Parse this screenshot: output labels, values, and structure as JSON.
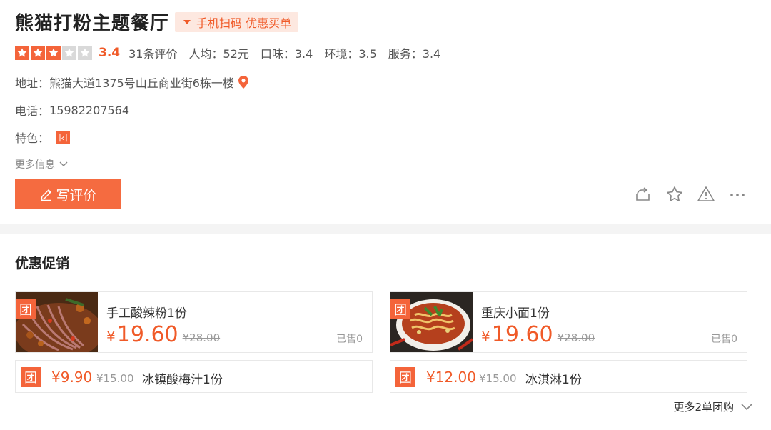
{
  "shop": {
    "title": "熊猫打粉主题餐厅",
    "scan_pay_label": "手机扫码 优惠买单",
    "rating": {
      "stars": 3,
      "max_stars": 5,
      "score": "3.4",
      "reviews": "31条评价",
      "avg_price": "人均：52元",
      "taste": "口味：3.4",
      "environment": "环境：3.5",
      "service": "服务：3.4"
    },
    "address_label": "地址：",
    "address": "熊猫大道1375号山丘商业街6栋一楼",
    "phone_label": "电话：",
    "phone": "15982207564",
    "feature_label": "特色：",
    "feature_badge": "团",
    "more_info": "更多信息",
    "write_review": "写评价",
    "icons": [
      "share-icon",
      "star-outline-icon",
      "warning-icon",
      "more-icon"
    ],
    "accent_color": "#f05a28"
  },
  "promo": {
    "title": "优惠促销",
    "badge": "团",
    "deals": [
      {
        "name": "手工酸辣粉1份",
        "yen": "¥",
        "price": "19.60",
        "original": "¥28.00",
        "sold": "已售0"
      },
      {
        "name": "重庆小面1份",
        "yen": "¥",
        "price": "19.60",
        "original": "¥28.00",
        "sold": "已售0"
      }
    ],
    "mini_deals": [
      {
        "price": "¥9.90",
        "original": "¥15.00",
        "name": "冰镇酸梅汁1份"
      },
      {
        "price": "¥12.00",
        "original": "¥15.00",
        "name": "冰淇淋1份"
      }
    ],
    "more": "更多2单团购"
  }
}
